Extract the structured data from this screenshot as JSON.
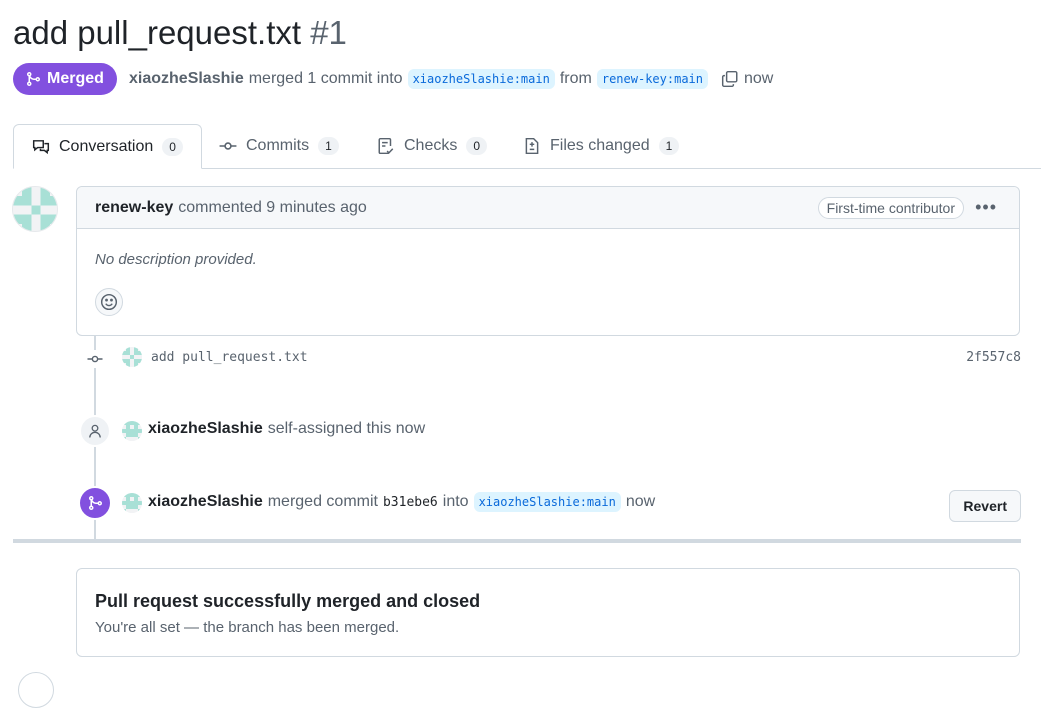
{
  "pr": {
    "title": "add pull_request.txt",
    "number": "#1",
    "state": "Merged",
    "author": "xiaozheSlashie",
    "merge_text": "merged 1 commit into",
    "base_branch": "xiaozheSlashie:main",
    "from_text": "from",
    "head_branch": "renew-key:main",
    "time": "now"
  },
  "tabs": [
    {
      "label": "Conversation",
      "count": "0",
      "icon": "comment-discussion-icon"
    },
    {
      "label": "Commits",
      "count": "1",
      "icon": "git-commit-icon"
    },
    {
      "label": "Checks",
      "count": "0",
      "icon": "checklist-icon"
    },
    {
      "label": "Files changed",
      "count": "1",
      "icon": "file-diff-icon"
    }
  ],
  "comment": {
    "author": "renew-key",
    "action": "commented 9 minutes ago",
    "badge": "First-time contributor",
    "body": "No description provided."
  },
  "timeline": {
    "commit": {
      "message": "add pull_request.txt",
      "sha": "2f557c8"
    },
    "assign": {
      "actor": "xiaozheSlashie",
      "text": "self-assigned this now"
    },
    "merge": {
      "actor": "xiaozheSlashie",
      "text": "merged commit",
      "sha": "b31ebe6",
      "into": "into",
      "branch": "xiaozheSlashie:main",
      "time": "now",
      "revert_label": "Revert"
    }
  },
  "merged_box": {
    "title": "Pull request successfully merged and closed",
    "subtitle": "You're all set — the branch has been merged."
  },
  "colors": {
    "merged_purple": "#8250df",
    "branch_bg": "#ddf4ff",
    "branch_fg": "#0969da",
    "avatar_teal": "#a8e0d6"
  }
}
